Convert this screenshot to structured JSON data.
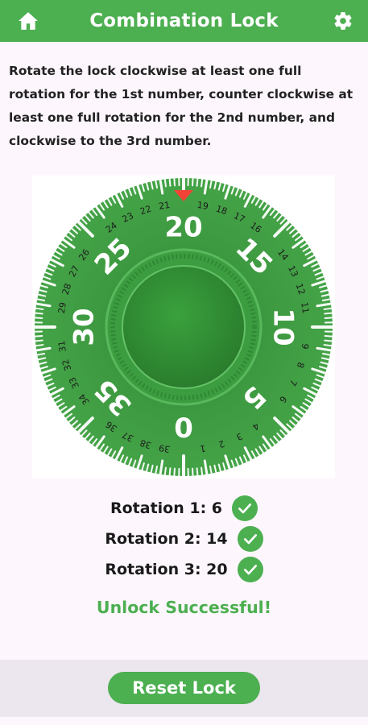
{
  "header": {
    "title": "Combination Lock",
    "home_icon": "home-icon",
    "settings_icon": "gear-icon"
  },
  "instructions": "Rotate the lock clockwise at least one full rotation for the 1st number, counter clockwise at least one full rotation for the 2nd number, and clockwise to the 3rd number.",
  "dial": {
    "numbers": 40,
    "top_value": 20,
    "major_labels": [
      "0",
      "5",
      "10",
      "15",
      "20",
      "25",
      "30",
      "35"
    ],
    "minor_labels": [
      "1",
      "2",
      "3",
      "4",
      "6",
      "7",
      "8",
      "9",
      "11",
      "12",
      "13",
      "14",
      "16",
      "17",
      "18",
      "19",
      "21",
      "22",
      "23",
      "24",
      "26",
      "27",
      "28",
      "29",
      "31",
      "32",
      "33",
      "34",
      "36",
      "37",
      "38",
      "39"
    ],
    "colors": {
      "dial": "#44a347",
      "dial_dark": "#2e7d32",
      "pointer": "#f44336",
      "ticks": "#ffffff"
    }
  },
  "rotations": [
    {
      "label": "Rotation 1: 6",
      "done": true
    },
    {
      "label": "Rotation 2: 14",
      "done": true
    },
    {
      "label": "Rotation 3: 20",
      "done": true
    }
  ],
  "status_message": "Unlock Successful!",
  "reset_button": "Reset Lock",
  "colors": {
    "primary": "#4caf50",
    "background": "#fdf7fd",
    "footer": "#ece6ee"
  }
}
